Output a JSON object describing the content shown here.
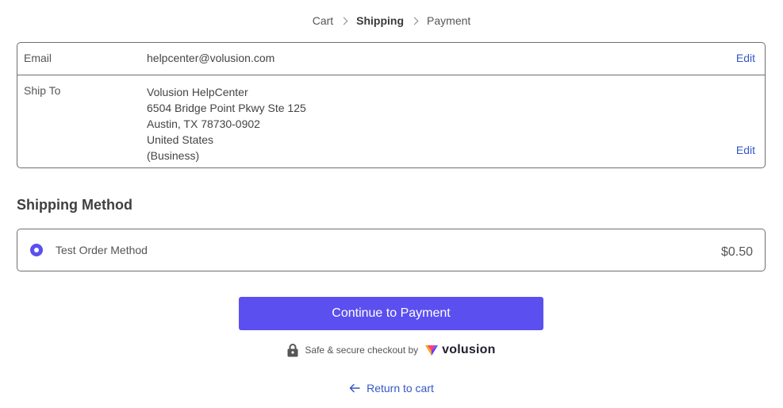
{
  "breadcrumb": {
    "items": [
      {
        "label": "Cart"
      },
      {
        "label": "Shipping"
      },
      {
        "label": "Payment"
      }
    ]
  },
  "contact": {
    "email_label": "Email",
    "email_value": "helpcenter@volusion.com",
    "edit_label": "Edit"
  },
  "ship_to": {
    "label": "Ship To",
    "lines": [
      "Volusion HelpCenter",
      "6504 Bridge Point Pkwy Ste 125",
      "Austin, TX 78730-0902",
      "United States",
      "(Business)"
    ],
    "edit_label": "Edit"
  },
  "shipping_method": {
    "title": "Shipping Method",
    "option_name": "Test Order Method",
    "option_price": "$0.50"
  },
  "continue_button": "Continue to Payment",
  "secure": {
    "text": "Safe & secure checkout by",
    "brand": "volusion",
    "icons": [
      "lock-icon",
      "volusion-logo-icon"
    ]
  },
  "return_link": "Return to cart",
  "colors": {
    "accent": "#5b4ff0",
    "link": "#3557c7",
    "border": "#6f6f6f"
  }
}
